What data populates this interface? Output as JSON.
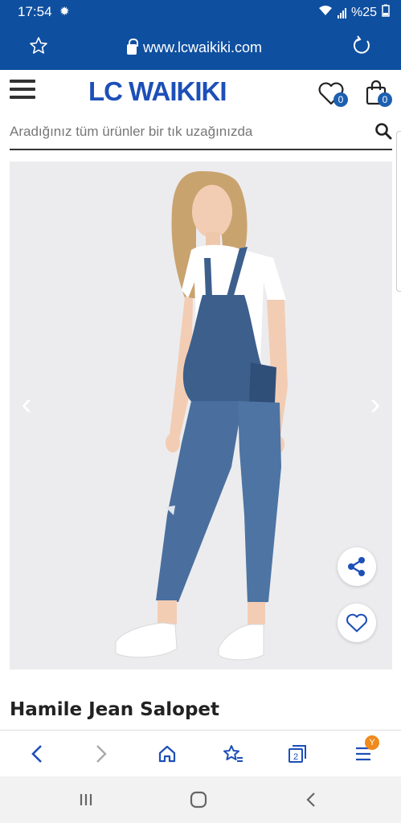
{
  "status_bar": {
    "time": "17:54",
    "battery": "%25"
  },
  "browser": {
    "url": "www.lcwaikiki.com"
  },
  "header": {
    "logo": "LC WAIKIKI",
    "wishlist_count": "0",
    "cart_count": "0"
  },
  "search": {
    "placeholder": "Aradığınız tüm ürünler bir tık uzağınızda"
  },
  "product": {
    "title": "Hamile Jean Salopet"
  },
  "bottom_nav": {
    "tabs_count": "2",
    "menu_badge": "Y"
  },
  "colors": {
    "brand_blue": "#0f4fa0",
    "logo_blue": "#1d4fb8",
    "badge_orange": "#f08a1c",
    "denim": "#3c5f8c"
  }
}
